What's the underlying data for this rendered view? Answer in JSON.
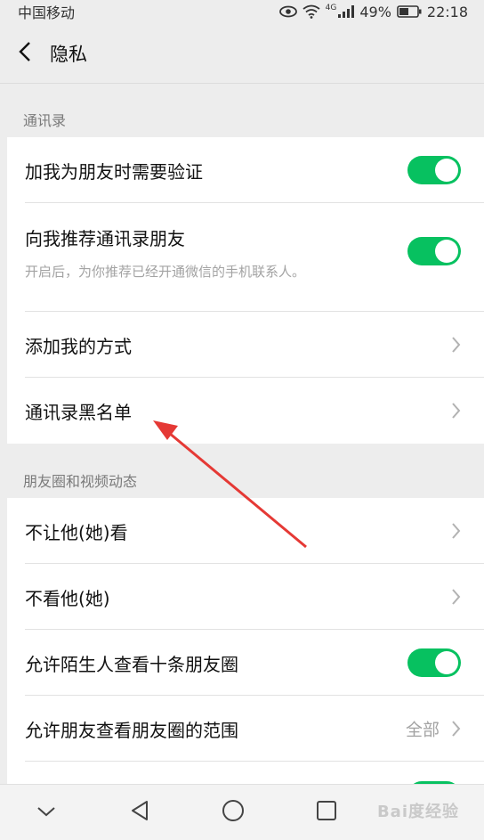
{
  "status_bar": {
    "carrier": "中国移动",
    "network": "4G",
    "battery": "49%",
    "time": "22:18"
  },
  "nav": {
    "title": "隐私"
  },
  "sections": {
    "contacts_header": "通讯录",
    "moments_header": "朋友圈和视频动态"
  },
  "contacts": {
    "verify_label": "加我为朋友时需要验证",
    "verify_on": true,
    "recommend_label": "向我推荐通讯录朋友",
    "recommend_on": true,
    "recommend_desc": "开启后，为你推荐已经开通微信的手机联系人。",
    "add_methods_label": "添加我的方式",
    "blacklist_label": "通讯录黑名单"
  },
  "moments": {
    "hide_from_label": "不让他(她)看",
    "dont_see_label": "不看他(她)",
    "stranger_ten_label": "允许陌生人查看十条朋友圈",
    "stranger_ten_on": true,
    "range_label": "允许朋友查看朋友圈的范围",
    "range_value": "全部"
  },
  "watermark": "Bai度经验",
  "colors": {
    "toggle_on": "#07c160",
    "annotation_arrow": "#e53935"
  }
}
